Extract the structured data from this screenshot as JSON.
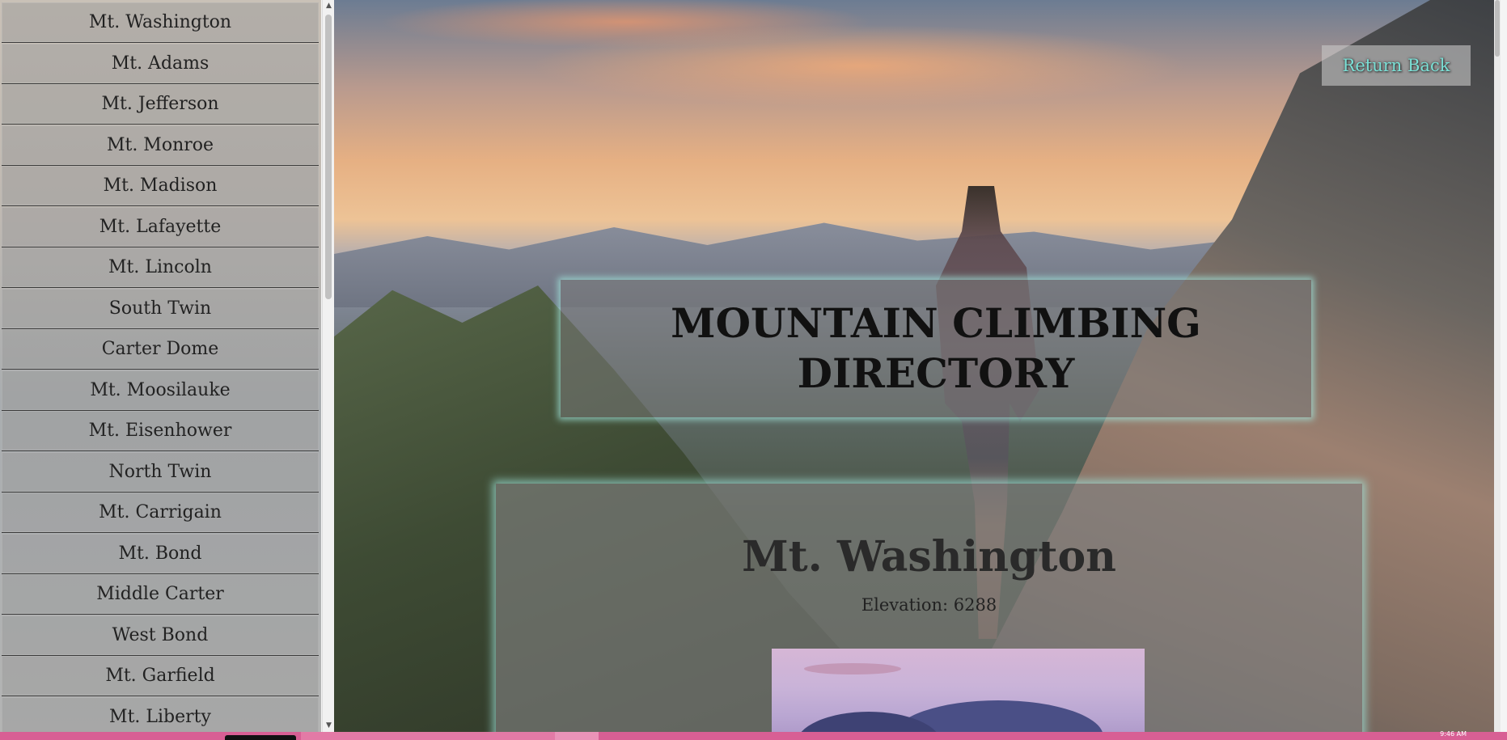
{
  "sidebar": {
    "items": [
      {
        "label": "Mt. Washington"
      },
      {
        "label": "Mt. Adams"
      },
      {
        "label": "Mt. Jefferson"
      },
      {
        "label": "Mt. Monroe"
      },
      {
        "label": "Mt. Madison"
      },
      {
        "label": "Mt. Lafayette"
      },
      {
        "label": "Mt. Lincoln"
      },
      {
        "label": "South Twin"
      },
      {
        "label": "Carter Dome"
      },
      {
        "label": "Mt. Moosilauke"
      },
      {
        "label": "Mt. Eisenhower"
      },
      {
        "label": "North Twin"
      },
      {
        "label": "Mt. Carrigain"
      },
      {
        "label": "Mt. Bond"
      },
      {
        "label": "Middle Carter"
      },
      {
        "label": "West Bond"
      },
      {
        "label": "Mt. Garfield"
      },
      {
        "label": "Mt. Liberty"
      }
    ]
  },
  "header": {
    "return_label": "Return Back",
    "title": "MOUNTAIN CLIMBING DIRECTORY"
  },
  "detail": {
    "name": "Mt. Washington",
    "elevation": "Elevation: 6288"
  },
  "taskbar": {
    "clock": "9:46 AM"
  },
  "colors": {
    "accent_glow": "#a0e6dc",
    "return_text": "#7be0d6",
    "taskbar": "#d85f94"
  }
}
